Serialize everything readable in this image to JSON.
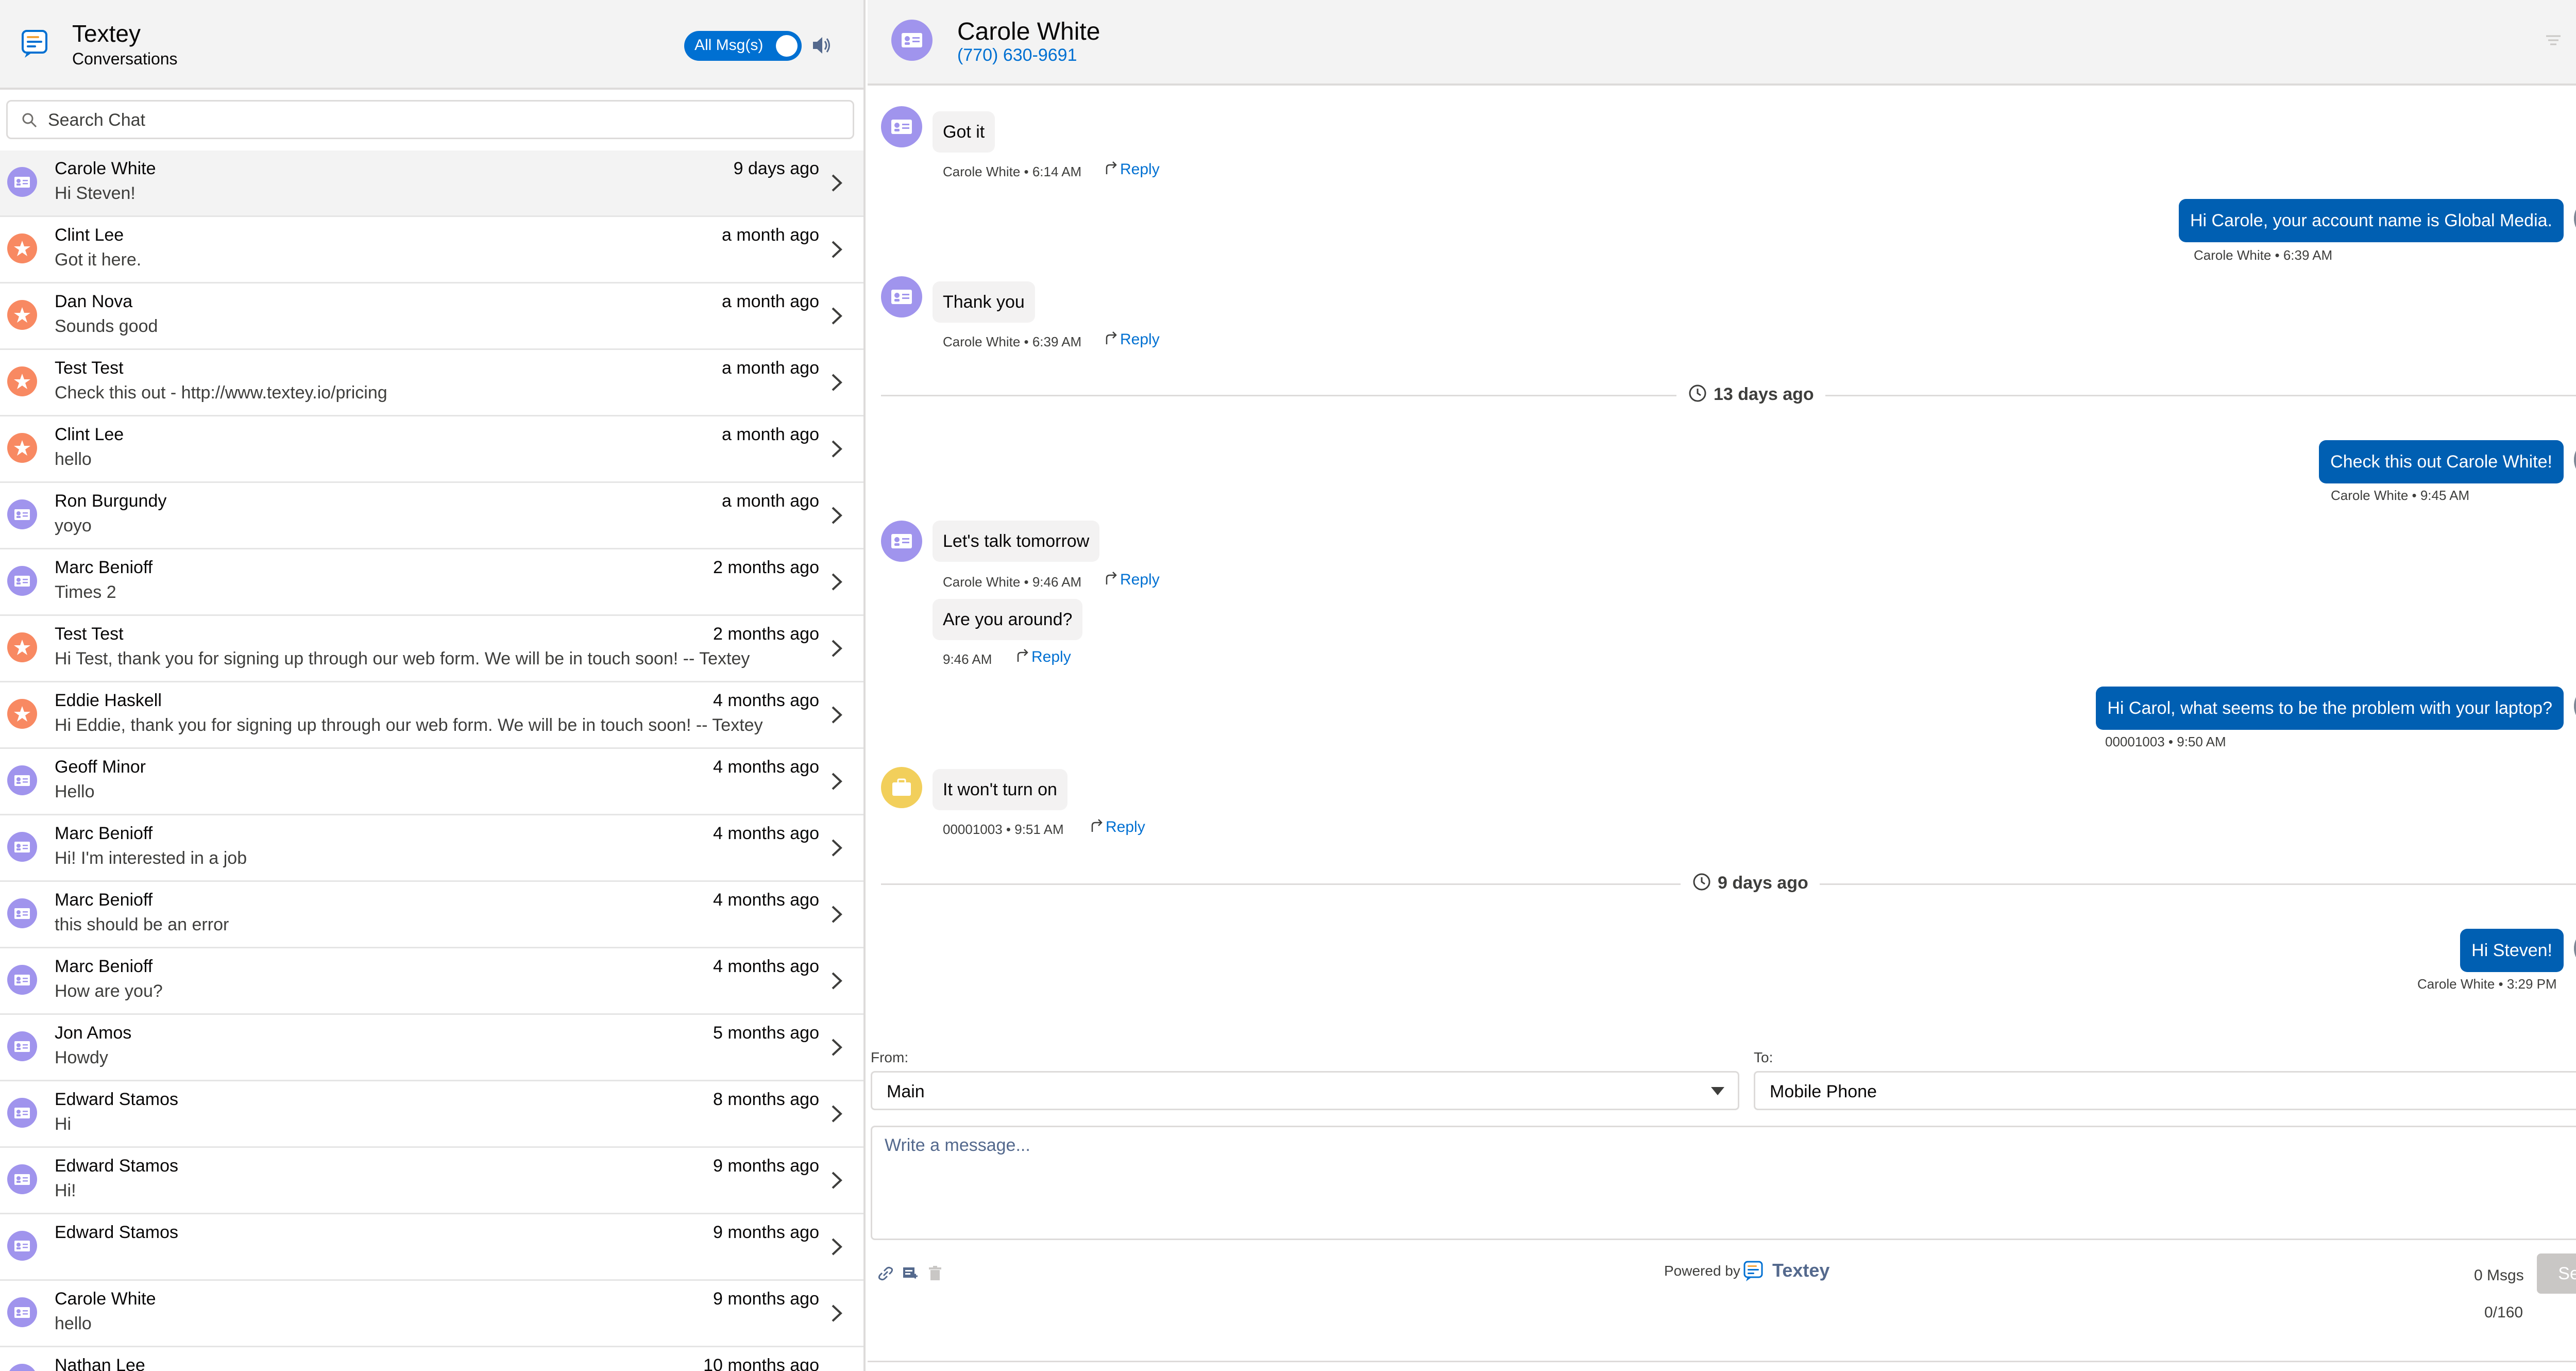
{
  "app": {
    "name": "Textey",
    "subtitle": "Conversations",
    "toggle_label": "All Msg(s)"
  },
  "search": {
    "placeholder": "Search Chat"
  },
  "conversations": [
    {
      "name": "Carole White",
      "time": "9 days ago",
      "message": "Hi Steven!",
      "type": "contact",
      "active": true
    },
    {
      "name": "Clint Lee",
      "time": "a month ago",
      "message": "Got it here.",
      "type": "lead"
    },
    {
      "name": "Dan Nova",
      "time": "a month ago",
      "message": "Sounds good",
      "type": "lead"
    },
    {
      "name": "Test Test",
      "time": "a month ago",
      "message": "Check this out - http://www.textey.io/pricing",
      "type": "lead"
    },
    {
      "name": "Clint Lee",
      "time": "a month ago",
      "message": "hello",
      "type": "lead"
    },
    {
      "name": "Ron Burgundy",
      "time": "a month ago",
      "message": "yoyo",
      "type": "contact"
    },
    {
      "name": "Marc Benioff",
      "time": "2 months ago",
      "message": "Times 2",
      "type": "contact"
    },
    {
      "name": "Test Test",
      "time": "2 months ago",
      "message": "Hi Test, thank you for signing up through our web form. We will be in touch soon! -- Textey",
      "type": "lead"
    },
    {
      "name": "Eddie Haskell",
      "time": "4 months ago",
      "message": "Hi Eddie, thank you for signing up through our web form. We will be in touch soon! -- Textey",
      "type": "lead"
    },
    {
      "name": "Geoff Minor",
      "time": "4 months ago",
      "message": "Hello",
      "type": "contact"
    },
    {
      "name": "Marc Benioff",
      "time": "4 months ago",
      "message": "Hi! I'm interested in a job",
      "type": "contact"
    },
    {
      "name": "Marc Benioff",
      "time": "4 months ago",
      "message": "this should be an error",
      "type": "contact"
    },
    {
      "name": "Marc Benioff",
      "time": "4 months ago",
      "message": "How are you?",
      "type": "contact"
    },
    {
      "name": "Jon Amos",
      "time": "5 months ago",
      "message": "Howdy",
      "type": "contact"
    },
    {
      "name": "Edward Stamos",
      "time": "8 months ago",
      "message": "Hi",
      "type": "contact"
    },
    {
      "name": "Edward Stamos",
      "time": "9 months ago",
      "message": "Hi!",
      "type": "contact"
    },
    {
      "name": "Edward Stamos",
      "time": "9 months ago",
      "message": "",
      "type": "contact"
    },
    {
      "name": "Carole White",
      "time": "9 months ago",
      "message": "hello",
      "type": "contact"
    },
    {
      "name": "Nathan Lee",
      "time": "10 months ago",
      "message": "",
      "type": "contact"
    }
  ],
  "header": {
    "name": "Carole White",
    "phone": "(770) 630-9691"
  },
  "messages": {
    "m1": {
      "text": "Got it",
      "meta": "Carole White • 6:14 AM",
      "reply": "Reply"
    },
    "m2": {
      "text": "Hi Carole, your account name is Global Media.",
      "meta": "Carole White • 6:39 AM"
    },
    "m3": {
      "text": "Thank you",
      "meta": "Carole White • 6:39 AM",
      "reply": "Reply"
    },
    "d1": {
      "label": "13 days ago"
    },
    "m4": {
      "text": "Check this out Carole White!",
      "meta": "Carole White • 9:45 AM"
    },
    "m5": {
      "text": "Let's talk tomorrow",
      "meta": "Carole White • 9:46 AM",
      "reply": "Reply"
    },
    "m6": {
      "text": "Are you around?",
      "meta": "9:46 AM",
      "reply": "Reply"
    },
    "m7": {
      "text": "Hi Carol, what seems to be the problem with your laptop?",
      "meta": "00001003 • 9:50 AM"
    },
    "m8": {
      "text": "It won't turn on",
      "meta": "00001003 • 9:51 AM",
      "reply": "Reply"
    },
    "d2": {
      "label": "9 days ago"
    },
    "m9": {
      "text": "Hi Steven!",
      "meta": "Carole White • 3:29 PM"
    }
  },
  "composer": {
    "from_label": "From:",
    "from_value": "Main",
    "to_label": "To:",
    "to_value": "Mobile Phone",
    "placeholder": "Write a message...",
    "powered_by": "Powered by",
    "brand": "Textey",
    "msg_count": "0 Msgs",
    "send_label": "Send",
    "char_count": "0/160"
  },
  "colors": {
    "accent": "#0070d2",
    "outgoing_bubble": "#005fb2",
    "contact_avatar": "#a094ed",
    "lead_avatar": "#f88962",
    "case_avatar": "#f2cf5b"
  }
}
